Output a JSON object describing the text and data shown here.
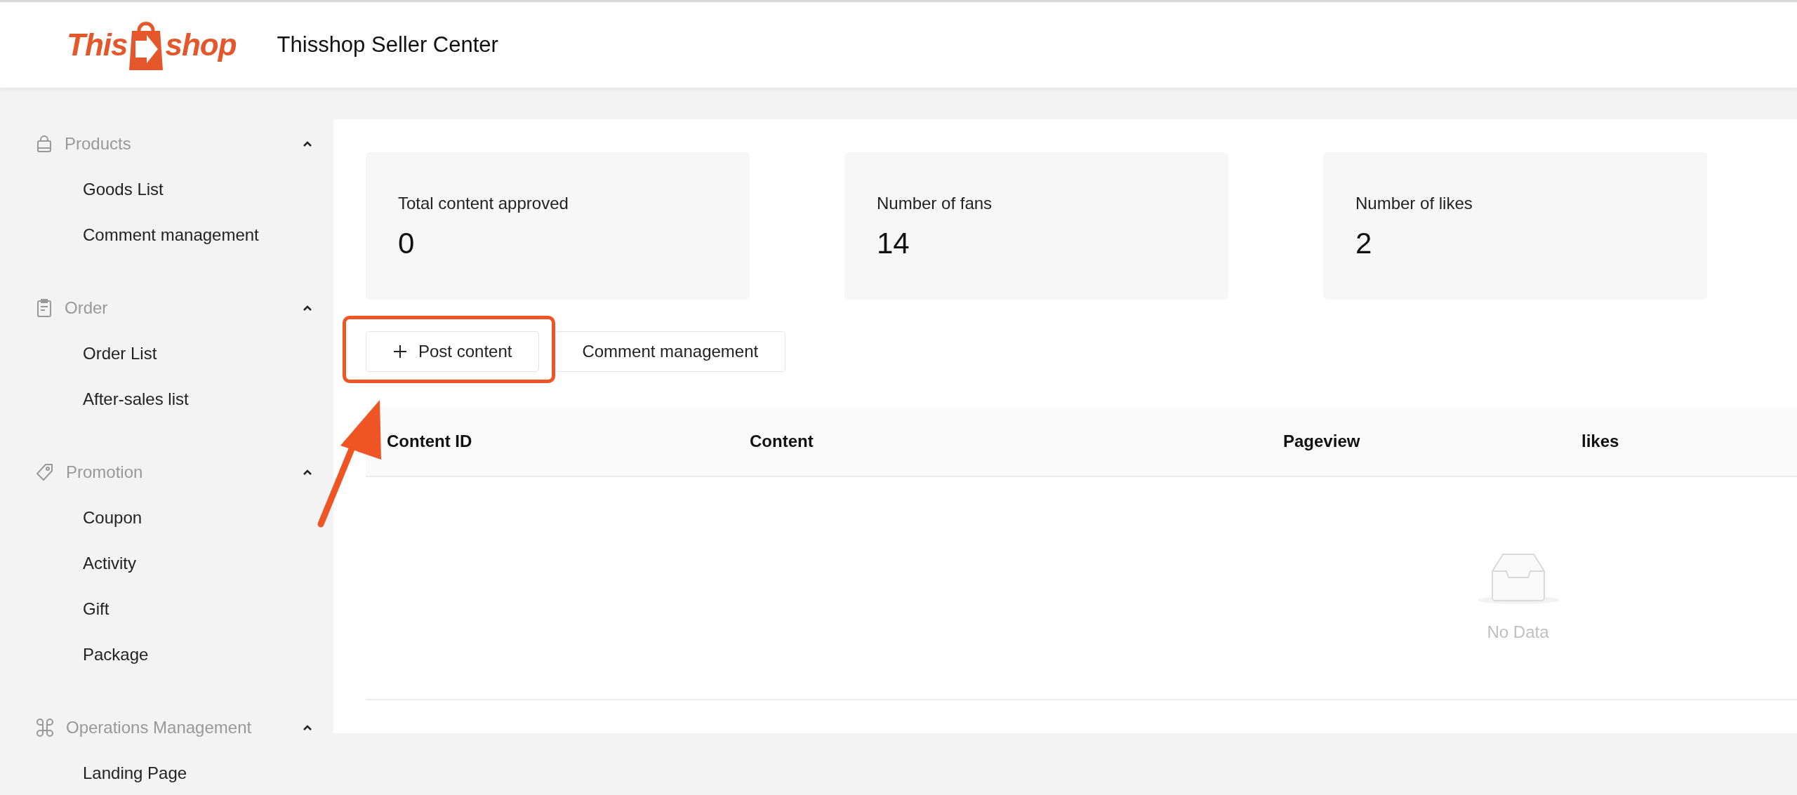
{
  "header": {
    "logo": {
      "text_1": "This",
      "text_2": "shop"
    },
    "title": "Thisshop Seller Center"
  },
  "sidebar": {
    "sections": [
      {
        "label": "Products",
        "expanded": true,
        "items": [
          "Goods List",
          "Comment management"
        ]
      },
      {
        "label": "Order",
        "expanded": true,
        "items": [
          "Order List",
          "After-sales list"
        ]
      },
      {
        "label": "Promotion",
        "expanded": true,
        "items": [
          "Coupon",
          "Activity",
          "Gift",
          "Package"
        ]
      },
      {
        "label": "Operations Management",
        "expanded": true,
        "items": [
          "Landing Page"
        ]
      }
    ]
  },
  "stats": [
    {
      "label": "Total content approved",
      "value": "0"
    },
    {
      "label": "Number of fans",
      "value": "14"
    },
    {
      "label": "Number of likes",
      "value": "2"
    }
  ],
  "buttons": [
    {
      "label": "Post content",
      "kind": "add",
      "highlighted": true
    },
    {
      "label": "Comment management",
      "kind": "plain",
      "highlighted": false
    }
  ],
  "table": {
    "columns": [
      "Content ID",
      "Content",
      "Pageview",
      "likes"
    ],
    "empty_text": "No Data"
  }
}
